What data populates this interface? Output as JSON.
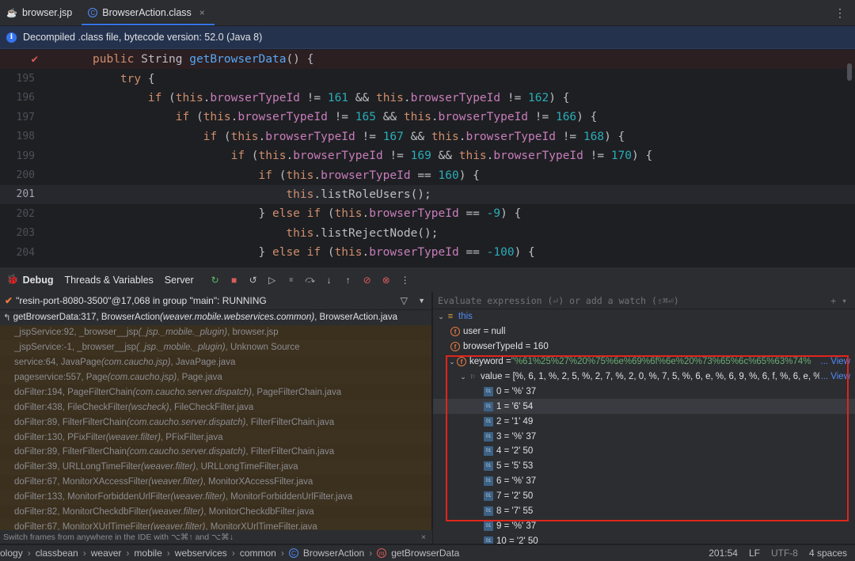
{
  "tabs": [
    {
      "label": "browser.jsp",
      "icon": "jsp-file-icon",
      "active": false
    },
    {
      "label": "BrowserAction.class",
      "icon": "class-file-icon",
      "active": true
    }
  ],
  "banner": {
    "text": "Decompiled .class file, bytecode version: 52.0 (Java 8)"
  },
  "editor": {
    "lines": [
      {
        "num": "",
        "segs": [
          [
            "kw",
            "public "
          ],
          [
            "",
            "String "
          ],
          [
            "fn",
            "getBrowserData"
          ],
          [
            "",
            "() {"
          ]
        ]
      },
      {
        "num": "195",
        "segs": [
          [
            "kw",
            "    try "
          ],
          [
            "",
            "{"
          ]
        ]
      },
      {
        "num": "196",
        "segs": [
          [
            "kw",
            "        if "
          ],
          [
            "",
            "("
          ],
          [
            "kw",
            "this"
          ],
          [
            "",
            "."
          ],
          [
            "fld",
            "browserTypeId"
          ],
          [
            "",
            " != "
          ],
          [
            "num",
            "161"
          ],
          [
            "",
            " && "
          ],
          [
            "kw",
            "this"
          ],
          [
            "",
            "."
          ],
          [
            "fld",
            "browserTypeId"
          ],
          [
            "",
            " != "
          ],
          [
            "num",
            "162"
          ],
          [
            "",
            ") {"
          ]
        ]
      },
      {
        "num": "197",
        "segs": [
          [
            "kw",
            "            if "
          ],
          [
            "",
            "("
          ],
          [
            "kw",
            "this"
          ],
          [
            "",
            "."
          ],
          [
            "fld",
            "browserTypeId"
          ],
          [
            "",
            " != "
          ],
          [
            "num",
            "165"
          ],
          [
            "",
            " && "
          ],
          [
            "kw",
            "this"
          ],
          [
            "",
            "."
          ],
          [
            "fld",
            "browserTypeId"
          ],
          [
            "",
            " != "
          ],
          [
            "num",
            "166"
          ],
          [
            "",
            ") {"
          ]
        ]
      },
      {
        "num": "198",
        "segs": [
          [
            "kw",
            "                if "
          ],
          [
            "",
            "("
          ],
          [
            "kw",
            "this"
          ],
          [
            "",
            "."
          ],
          [
            "fld",
            "browserTypeId"
          ],
          [
            "",
            " != "
          ],
          [
            "num",
            "167"
          ],
          [
            "",
            " && "
          ],
          [
            "kw",
            "this"
          ],
          [
            "",
            "."
          ],
          [
            "fld",
            "browserTypeId"
          ],
          [
            "",
            " != "
          ],
          [
            "num",
            "168"
          ],
          [
            "",
            ") {"
          ]
        ]
      },
      {
        "num": "199",
        "segs": [
          [
            "kw",
            "                    if "
          ],
          [
            "",
            "("
          ],
          [
            "kw",
            "this"
          ],
          [
            "",
            "."
          ],
          [
            "fld",
            "browserTypeId"
          ],
          [
            "",
            " != "
          ],
          [
            "num",
            "169"
          ],
          [
            "",
            " && "
          ],
          [
            "kw",
            "this"
          ],
          [
            "",
            "."
          ],
          [
            "fld",
            "browserTypeId"
          ],
          [
            "",
            " != "
          ],
          [
            "num",
            "170"
          ],
          [
            "",
            ") {"
          ]
        ]
      },
      {
        "num": "200",
        "segs": [
          [
            "kw",
            "                        if "
          ],
          [
            "",
            "("
          ],
          [
            "kw",
            "this"
          ],
          [
            "",
            "."
          ],
          [
            "fld",
            "browserTypeId"
          ],
          [
            "",
            " == "
          ],
          [
            "num",
            "160"
          ],
          [
            "",
            ") {"
          ]
        ]
      },
      {
        "num": "201",
        "segs": [
          [
            "kw",
            "                            this"
          ],
          [
            "",
            "."
          ],
          [
            "",
            "listRoleUsers();"
          ]
        ]
      },
      {
        "num": "202",
        "segs": [
          [
            "",
            "                        } "
          ],
          [
            "kw",
            "else if "
          ],
          [
            "",
            "("
          ],
          [
            "kw",
            "this"
          ],
          [
            "",
            "."
          ],
          [
            "fld",
            "browserTypeId"
          ],
          [
            "",
            " == "
          ],
          [
            "num",
            "-9"
          ],
          [
            "",
            ") {"
          ]
        ]
      },
      {
        "num": "203",
        "segs": [
          [
            "kw",
            "                            this"
          ],
          [
            "",
            "."
          ],
          [
            "",
            "listRejectNode();"
          ]
        ]
      },
      {
        "num": "204",
        "segs": [
          [
            "",
            "                        } "
          ],
          [
            "kw",
            "else if "
          ],
          [
            "",
            "("
          ],
          [
            "kw",
            "this"
          ],
          [
            "",
            "."
          ],
          [
            "fld",
            "browserTypeId"
          ],
          [
            "",
            " == "
          ],
          [
            "num",
            "-100"
          ],
          [
            "",
            ") {"
          ]
        ]
      }
    ]
  },
  "debug": {
    "title": "Debug",
    "tabs": [
      "Threads & Variables",
      "Server"
    ],
    "thread": "\"resin-port-8080-3500\"@17,068 in group \"main\": RUNNING",
    "frames": [
      [
        "getBrowserData:317, BrowserAction ",
        "(weaver.mobile.webservices.common)",
        ", BrowserAction.java"
      ],
      [
        "_jspService:92, _browser__jsp ",
        "(_jsp._mobile._plugin)",
        ", browser.jsp"
      ],
      [
        "_jspService:-1, _browser__jsp ",
        "(_jsp._mobile._plugin)",
        ", Unknown Source"
      ],
      [
        "service:64, JavaPage ",
        "(com.caucho.jsp)",
        ", JavaPage.java"
      ],
      [
        "pageservice:557, Page ",
        "(com.caucho.jsp)",
        ", Page.java"
      ],
      [
        "doFilter:194, PageFilterChain ",
        "(com.caucho.server.dispatch)",
        ", PageFilterChain.java"
      ],
      [
        "doFilter:438, FileCheckFilter ",
        "(wscheck)",
        ", FileCheckFilter.java"
      ],
      [
        "doFilter:89, FilterFilterChain ",
        "(com.caucho.server.dispatch)",
        ", FilterFilterChain.java"
      ],
      [
        "doFilter:130, PFixFilter ",
        "(weaver.filter)",
        ", PFixFilter.java"
      ],
      [
        "doFilter:89, FilterFilterChain ",
        "(com.caucho.server.dispatch)",
        ", FilterFilterChain.java"
      ],
      [
        "doFilter:39, URLLongTimeFilter ",
        "(weaver.filter)",
        ", URLLongTimeFilter.java"
      ],
      [
        "doFilter:67, MonitorXAccessFilter ",
        "(weaver.filter)",
        ", MonitorXAccessFilter.java"
      ],
      [
        "doFilter:133, MonitorForbiddenUrlFilter ",
        "(weaver.filter)",
        ", MonitorForbiddenUrlFilter.java"
      ],
      [
        "doFilter:82, MonitorCheckdbFilter ",
        "(weaver.filter)",
        ", MonitorCheckdbFilter.java"
      ],
      [
        "doFilter:67, MonitorXUrlTimeFilter ",
        "(weaver.filter)",
        ", MonitorXUrlTimeFilter.java"
      ]
    ],
    "hint": "Switch frames from anywhere in the IDE with ⌥⌘↑ and ⌥⌘↓"
  },
  "variables": {
    "eval_placeholder": "Evaluate expression (⏎) or add a watch (⇧⌘⏎)",
    "this_label": "this",
    "user": "user = null",
    "browserTypeId": "browserTypeId = 160",
    "keyword_name": "keyword = ",
    "keyword_value": "\"%61%25%27%20%75%6e%69%6f%6e%20%73%65%6c%65%63%74%",
    "value_row": "value = [%, 6, 1, %, 2, 5, %, 2, 7, %, 2, 0, %, 7, 5, %, 6, e, %, 6, 9, %, 6, f, %, 6, e, %,",
    "view_label": "... View",
    "items": [
      "0 = '%' 37",
      "1 = '6' 54",
      "2 = '1' 49",
      "3 = '%' 37",
      "4 = '2' 50",
      "5 = '5' 53",
      "6 = '%' 37",
      "7 = '2' 50",
      "8 = '7' 55",
      "9 = '%' 37",
      "10 = '2' 50"
    ]
  },
  "status": {
    "crumbs": [
      "ology",
      "classbean",
      "weaver",
      "mobile",
      "webservices",
      "common",
      "BrowserAction",
      "getBrowserData"
    ],
    "position": "201:54",
    "line_sep": "LF",
    "encoding": "UTF-8",
    "indent": "4 spaces"
  }
}
